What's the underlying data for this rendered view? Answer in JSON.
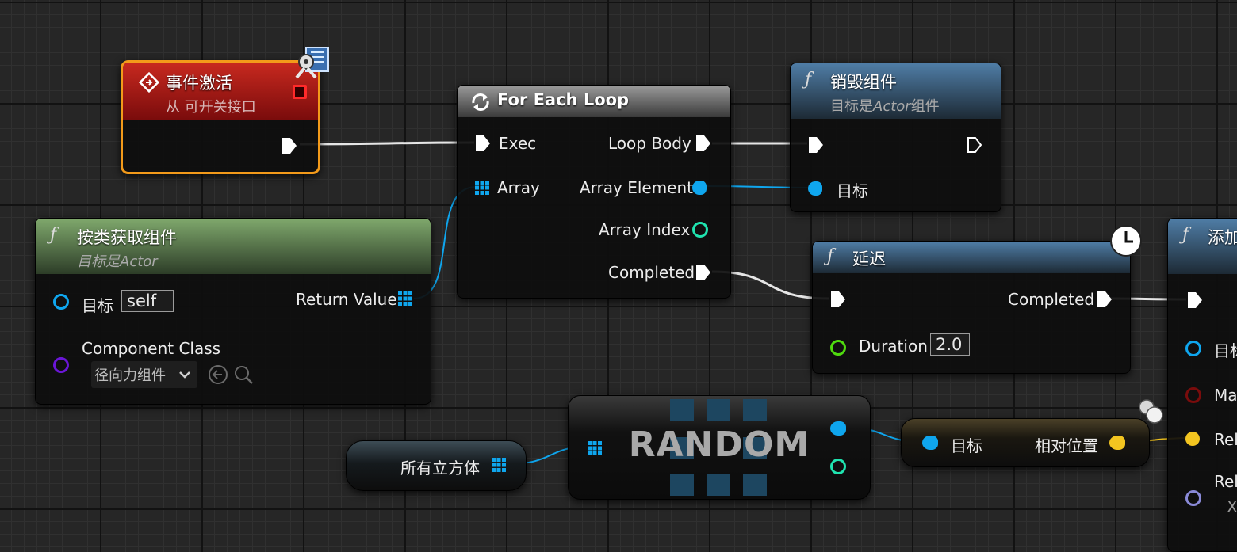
{
  "event_node": {
    "title": "事件激活",
    "subtitle": "从 可开关接口"
  },
  "getcomp_node": {
    "title": "按类获取组件",
    "subtitle": "目标是Actor",
    "target_label": "目标",
    "target_value": "self",
    "class_label": "Component Class",
    "class_value": "径向力组件",
    "return_label": "Return Value"
  },
  "foreach_node": {
    "title": "For Each Loop",
    "exec_in": "Exec",
    "array_in": "Array",
    "loop_body": "Loop Body",
    "array_element": "Array Element",
    "array_index": "Array Index",
    "completed": "Completed"
  },
  "destroy_node": {
    "title": "销毁组件",
    "subtitle_prefix": "目标是",
    "subtitle_italic": "Actor",
    "subtitle_suffix": "组件",
    "target_label": "目标"
  },
  "delay_node": {
    "title": "延迟",
    "completed": "Completed",
    "duration_label": "Duration",
    "duration_value": "2.0"
  },
  "add_node": {
    "title": "添加",
    "pin1": "目标",
    "pin2": "Ma",
    "pin3": "Rel",
    "pin4": "Rel",
    "pin4_sub": "X"
  },
  "variable_node": {
    "label": "所有立方体"
  },
  "random_node": {
    "label": "RANDOM"
  },
  "rel_loc_node": {
    "target_label": "目标",
    "out_label": "相对位置"
  },
  "colors": {
    "exec_wire": "#ffffff",
    "object_pin": "#0fa6ee",
    "int_pin": "#1fe3af",
    "float_pin": "#4fda0e",
    "class_pin": "#5a00b4",
    "vector_pin": "#f3c520",
    "event_header": "#a31616",
    "event_border": "#f39a1a",
    "function_header": "#3f6b8f",
    "pure_header": "#6f9a5f"
  }
}
